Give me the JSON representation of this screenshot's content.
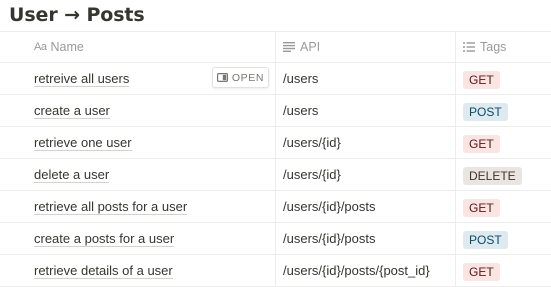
{
  "page": {
    "title": "User → Posts"
  },
  "columns": {
    "name": "Name",
    "api": "API",
    "tags": "Tags"
  },
  "open_label": "OPEN",
  "tag_colors": {
    "GET": {
      "bg": "#fbe4e4",
      "fg": "#5d1715"
    },
    "POST": {
      "bg": "#ddebf1",
      "fg": "#0b4b66"
    },
    "DELETE": {
      "bg": "#e9e5e3",
      "fg": "#44312a"
    }
  },
  "rows": [
    {
      "name": "retreive all users",
      "api": "/users",
      "tag": "GET"
    },
    {
      "name": "create a user",
      "api": "/users",
      "tag": "POST"
    },
    {
      "name": "retrieve one user",
      "api": "/users/{id}",
      "tag": "GET"
    },
    {
      "name": "delete a user",
      "api": "/users/{id}",
      "tag": "DELETE"
    },
    {
      "name": "retrieve all posts for a user",
      "api": "/users/{id}/posts",
      "tag": "GET"
    },
    {
      "name": "create a posts for a user",
      "api": "/users/{id}/posts",
      "tag": "POST"
    },
    {
      "name": "retrieve details of a user",
      "api": "/users/{id}/posts/{post_id}",
      "tag": "GET"
    }
  ]
}
